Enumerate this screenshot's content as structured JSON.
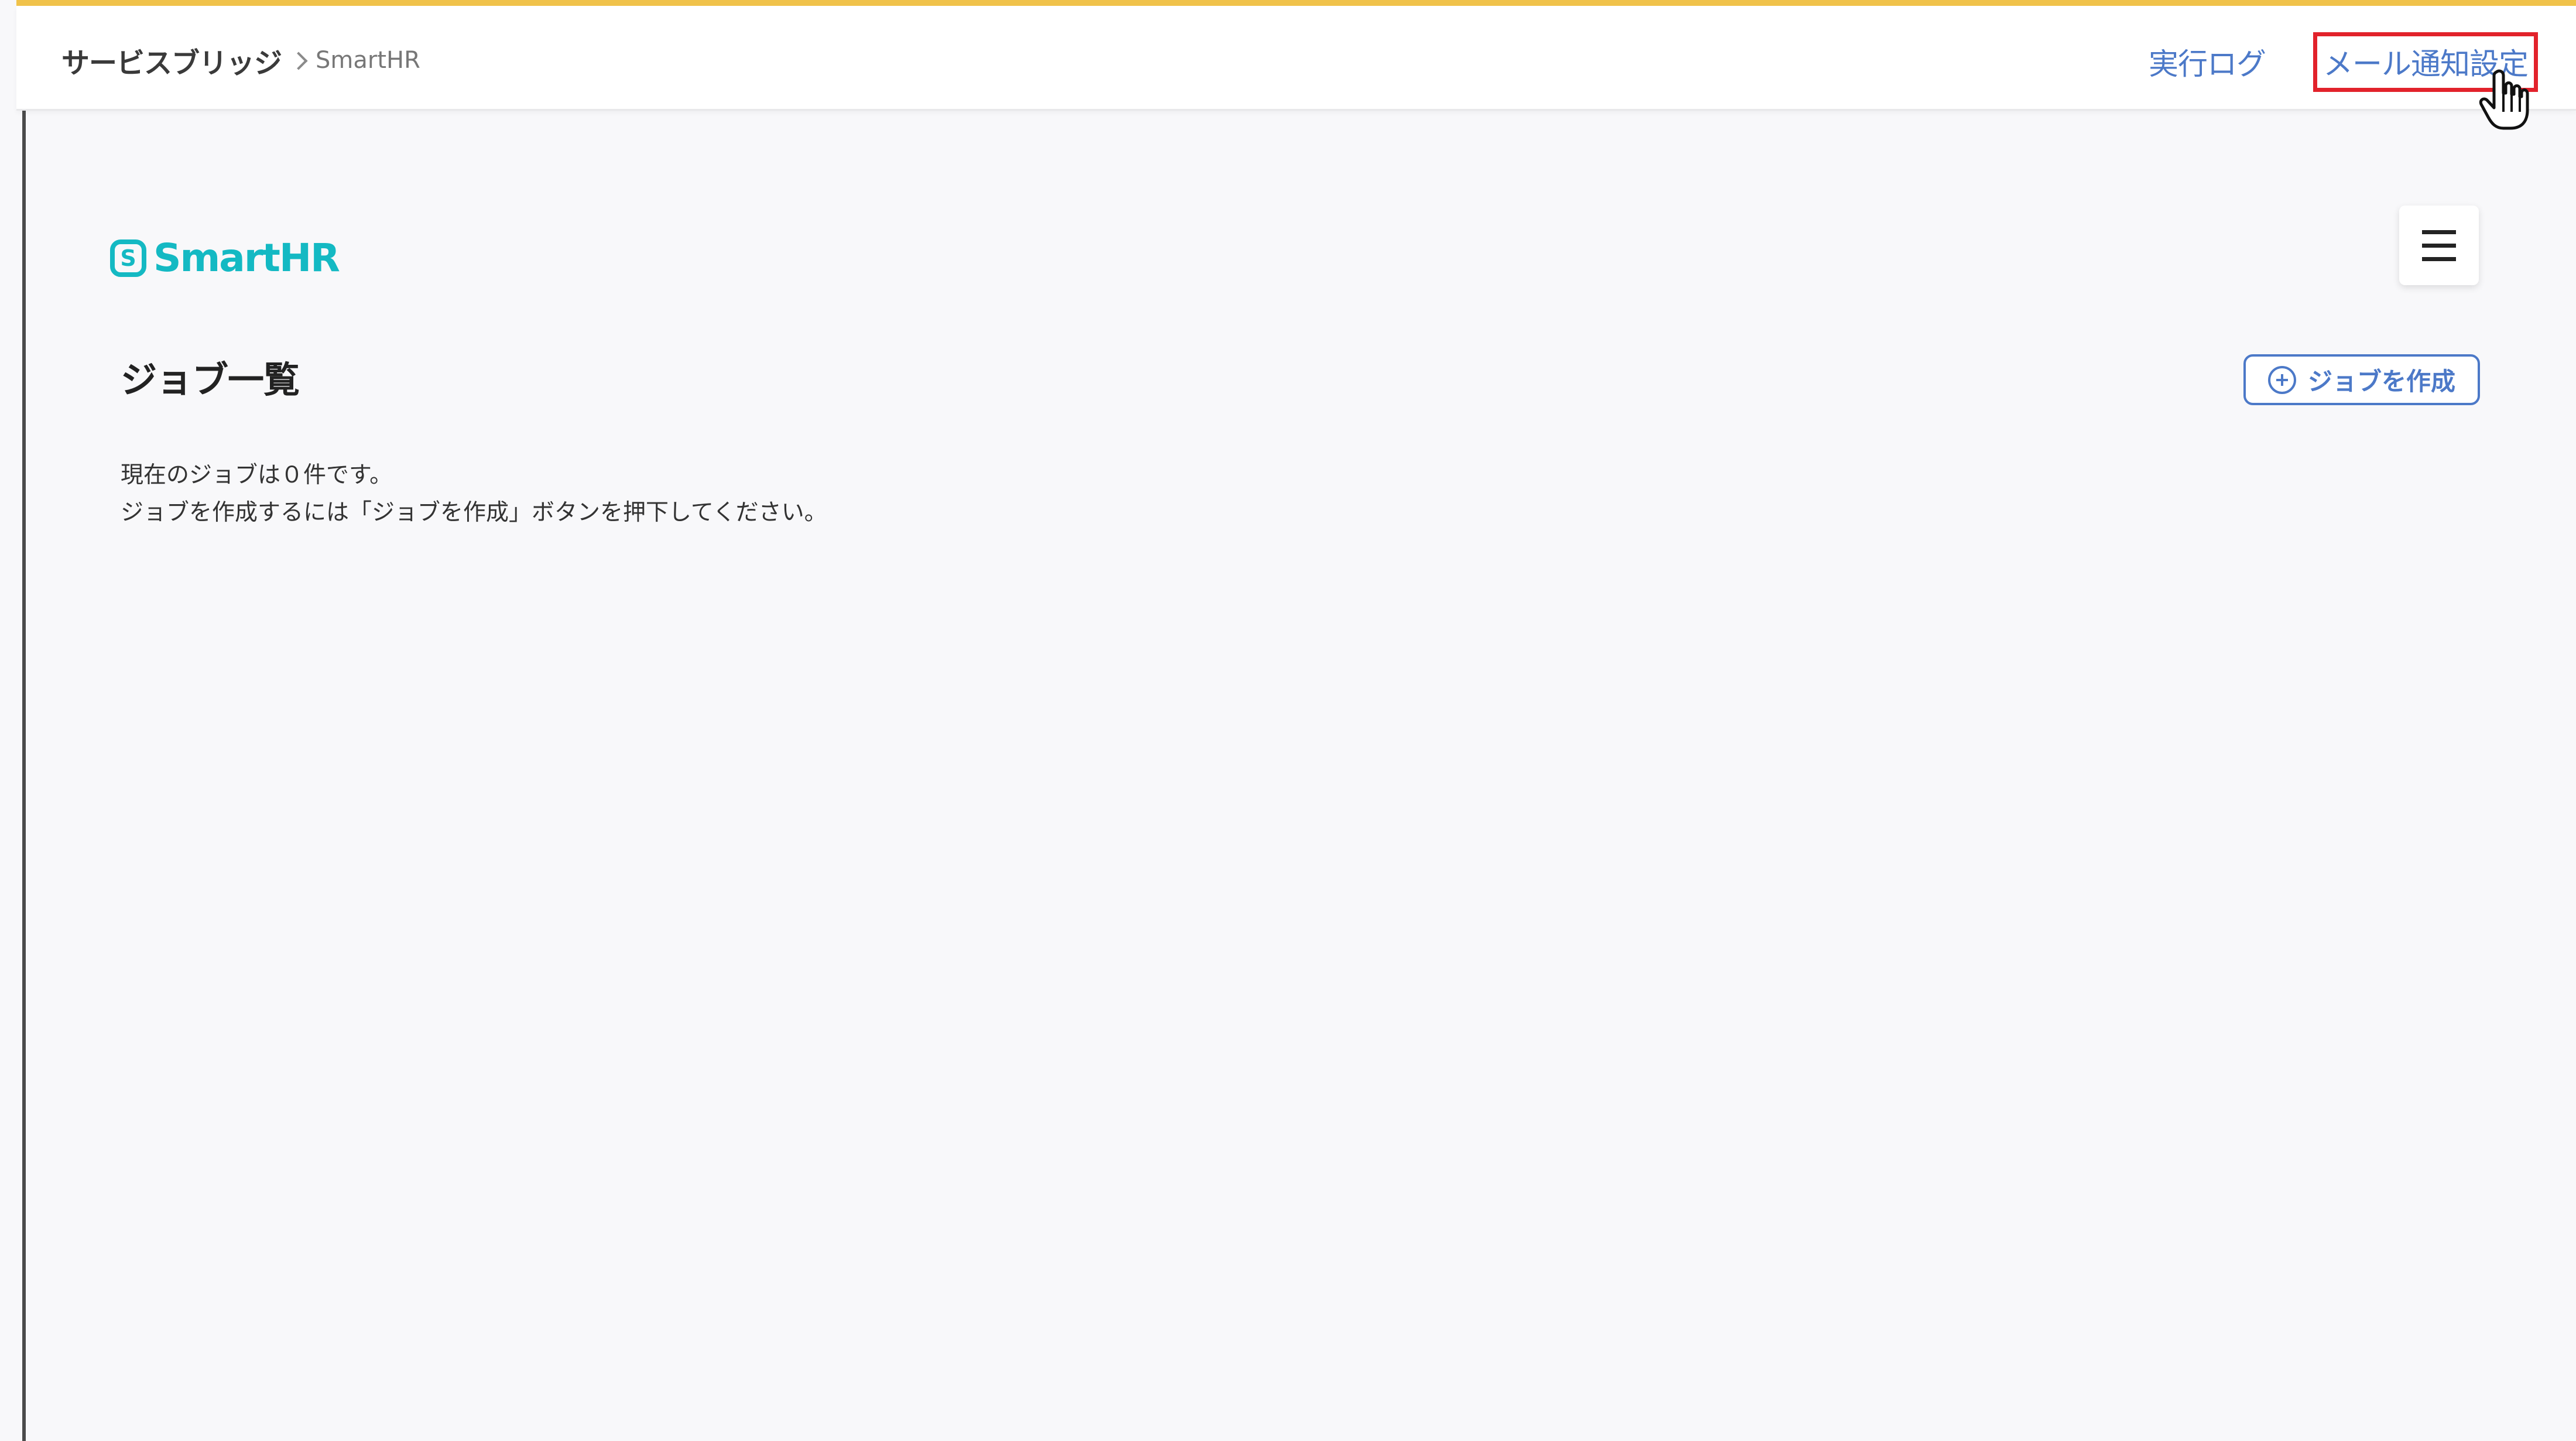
{
  "header": {
    "breadcrumb": {
      "root": "サービスブリッジ",
      "current": "SmartHR"
    },
    "links": {
      "execution_log": "実行ログ",
      "mail_notification_settings": "メール通知設定"
    }
  },
  "brand": {
    "logo_mark": "S",
    "logo_text": "SmartHR"
  },
  "main": {
    "title": "ジョブ一覧",
    "create_button_label": "ジョブを作成",
    "empty_message_line1": "現在のジョブは０件です。",
    "empty_message_line2": "ジョブを作成するには「ジョブを作成」ボタンを押下してください。"
  },
  "icons": {
    "breadcrumb_separator": "chevron-right-icon",
    "menu": "hamburger-menu-icon",
    "create": "plus-circle-icon",
    "cursor": "pointer-hand-icon"
  },
  "colors": {
    "accent_top": "#f0c24a",
    "link": "#4c79c8",
    "logo": "#14b9c3",
    "highlight": "#e2222b",
    "background": "#f8f8fa"
  }
}
